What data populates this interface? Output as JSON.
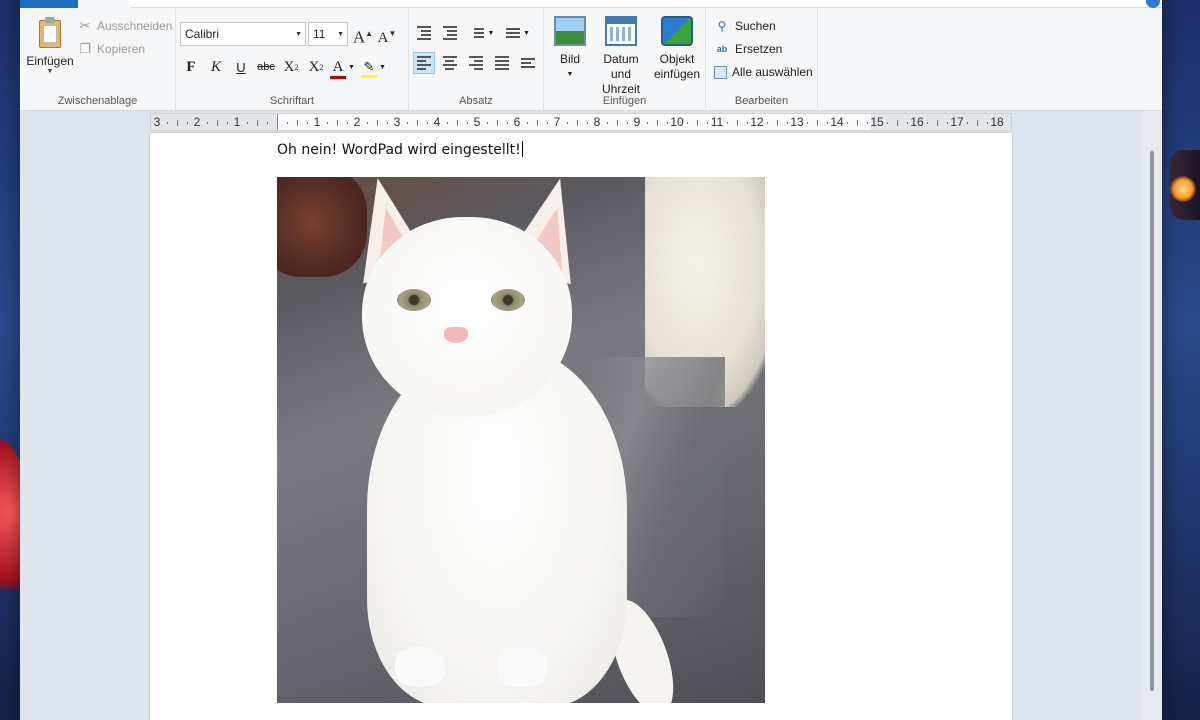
{
  "window": {
    "tab_file_label": "",
    "tab_start_label": ""
  },
  "ribbon": {
    "clipboard": {
      "title": "Zwischenablage",
      "paste_label": "Einfügen",
      "cut_label": "Ausschneiden",
      "copy_label": "Kopieren"
    },
    "font": {
      "title": "Schriftart",
      "font_name": "Calibri",
      "font_size": "11",
      "bold_label": "F",
      "italic_label": "K",
      "underline_label": "U",
      "strike_label": "abc",
      "subscript_label": "X",
      "superscript_label": "X",
      "color_letter": "A",
      "font_color": "#c00000",
      "highlight_color": "#ffff00"
    },
    "paragraph": {
      "title": "Absatz"
    },
    "insert": {
      "title": "Einfügen",
      "picture_label": "Bild",
      "datetime_label_1": "Datum und",
      "datetime_label_2": "Uhrzeit",
      "object_label_1": "Objekt",
      "object_label_2": "einfügen"
    },
    "edit": {
      "title": "Bearbeiten",
      "find_label": "Suchen",
      "replace_label": "Ersetzen",
      "select_all_label": "Alle auswählen"
    }
  },
  "ruler": {
    "left_labels": [
      "3",
      "2",
      "1"
    ],
    "right_labels": [
      "1",
      "2",
      "3",
      "4",
      "5",
      "6",
      "7",
      "8",
      "9",
      "10",
      "11",
      "12",
      "13",
      "14",
      "15",
      "16",
      "17",
      "18"
    ]
  },
  "document": {
    "text": "Oh nein! WordPad wird eingestellt!"
  },
  "colors": {
    "accent": "#1e6fc4",
    "active_align": "#cfe3f6"
  }
}
